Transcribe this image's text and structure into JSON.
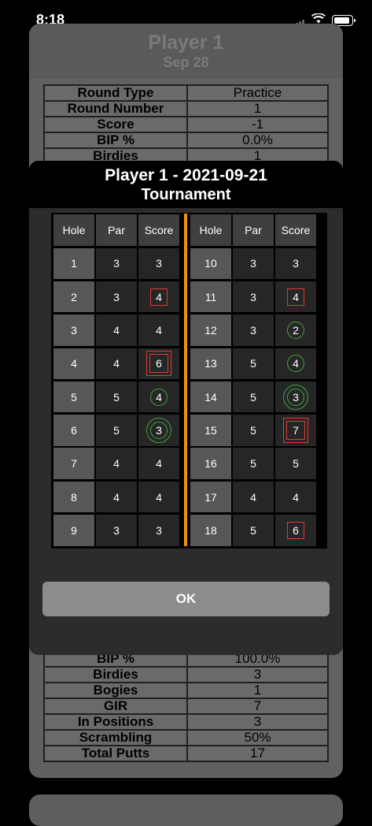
{
  "status_bar": {
    "time": "8:18"
  },
  "background_card": {
    "player": "Player 1",
    "date": "Sep 28",
    "top_rows": [
      {
        "label": "Round Type",
        "value": "Practice"
      },
      {
        "label": "Round Number",
        "value": "1"
      },
      {
        "label": "Score",
        "value": "-1"
      },
      {
        "label": "BIP %",
        "value": "0.0%"
      },
      {
        "label": "Birdies",
        "value": "1"
      }
    ],
    "bottom_rows": [
      {
        "label": "BIP %",
        "value": "100.0%"
      },
      {
        "label": "Birdies",
        "value": "3"
      },
      {
        "label": "Bogies",
        "value": "1"
      },
      {
        "label": "GIR",
        "value": "7"
      },
      {
        "label": "In Positions",
        "value": "3"
      },
      {
        "label": "Scrambling",
        "value": "50%"
      },
      {
        "label": "Total Putts",
        "value": "17"
      }
    ]
  },
  "modal": {
    "title": "Player 1 - 2021-09-21",
    "subtitle": "Tournament",
    "headers": {
      "hole": "Hole",
      "par": "Par",
      "score": "Score"
    },
    "front_nine": [
      {
        "hole": "1",
        "par": "3",
        "score": "3",
        "mark": "none"
      },
      {
        "hole": "2",
        "par": "3",
        "score": "4",
        "mark": "square"
      },
      {
        "hole": "3",
        "par": "4",
        "score": "4",
        "mark": "none"
      },
      {
        "hole": "4",
        "par": "4",
        "score": "6",
        "mark": "double-square"
      },
      {
        "hole": "5",
        "par": "5",
        "score": "4",
        "mark": "circle"
      },
      {
        "hole": "6",
        "par": "5",
        "score": "3",
        "mark": "double-circle"
      },
      {
        "hole": "7",
        "par": "4",
        "score": "4",
        "mark": "none"
      },
      {
        "hole": "8",
        "par": "4",
        "score": "4",
        "mark": "none"
      },
      {
        "hole": "9",
        "par": "3",
        "score": "3",
        "mark": "none"
      }
    ],
    "back_nine": [
      {
        "hole": "10",
        "par": "3",
        "score": "3",
        "mark": "none"
      },
      {
        "hole": "11",
        "par": "3",
        "score": "4",
        "mark": "square"
      },
      {
        "hole": "12",
        "par": "3",
        "score": "2",
        "mark": "circle"
      },
      {
        "hole": "13",
        "par": "5",
        "score": "4",
        "mark": "circle"
      },
      {
        "hole": "14",
        "par": "5",
        "score": "3",
        "mark": "double-circle"
      },
      {
        "hole": "15",
        "par": "5",
        "score": "7",
        "mark": "double-square"
      },
      {
        "hole": "16",
        "par": "5",
        "score": "5",
        "mark": "none"
      },
      {
        "hole": "17",
        "par": "4",
        "score": "4",
        "mark": "none"
      },
      {
        "hole": "18",
        "par": "5",
        "score": "6",
        "mark": "square"
      }
    ],
    "ok_label": "OK"
  },
  "colors": {
    "accent_divider": "#e8940f",
    "over_par": "#e53935",
    "under_par": "#43a047"
  }
}
